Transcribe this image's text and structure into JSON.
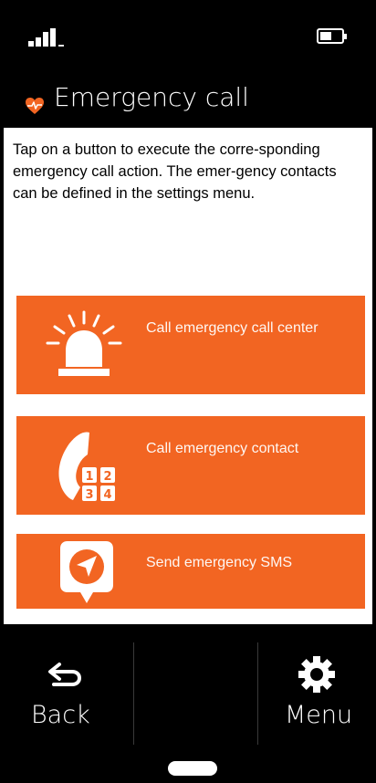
{
  "status_bar": {
    "signal_icon": "signal-icon",
    "battery_icon": "battery-icon"
  },
  "header": {
    "icon": "heart-pulse-icon",
    "title": "Emergency call",
    "accent": "#f26522"
  },
  "description": "Tap on a button to execute the corre-sponding emergency call action. The emer-gency contacts can be defined in the settings menu.",
  "actions": [
    {
      "label": "Call emergency call center",
      "icon": "siren-icon"
    },
    {
      "label": "Call emergency contact",
      "icon": "phone-keypad-icon"
    },
    {
      "label": "Send emergency SMS",
      "icon": "location-message-icon"
    }
  ],
  "bottom_bar": {
    "back_label": "Back",
    "menu_label": "Menu",
    "back_icon": "back-arrow-icon",
    "menu_icon": "gear-icon"
  },
  "colors": {
    "accent": "#f26522",
    "background": "#000000",
    "content": "#ffffff"
  }
}
